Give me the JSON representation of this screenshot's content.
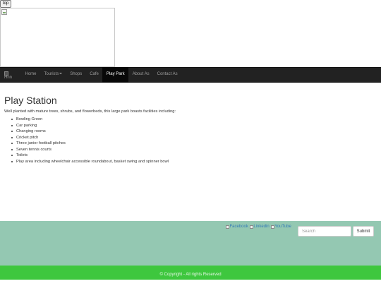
{
  "top_button": {
    "label": "top"
  },
  "navbar": {
    "logo_alt": "Hnn",
    "items": [
      {
        "label": "Home"
      },
      {
        "label": "Tourists"
      },
      {
        "label": "Shops"
      },
      {
        "label": "Cafe"
      },
      {
        "label": "Play Park"
      },
      {
        "label": "About As"
      },
      {
        "label": "Contact As"
      }
    ]
  },
  "main": {
    "title": "Play Station",
    "intro": "Well planted with mature trees, shrubs, and flowerbeds, this large park boasts facilities including:",
    "facilities": [
      "Bowling Green",
      "Car parking",
      "Changing rooms",
      "Cricket pitch",
      "Three junior football pitches",
      "Seven tennis courts",
      "Toilets",
      "Play area including wheelchair accessible roundabout, basket swing and spinner bowl"
    ]
  },
  "footer": {
    "social": [
      {
        "label": "Facebook",
        "icon": "facebook-icon"
      },
      {
        "label": "Linkedin",
        "icon": "linkedin-icon"
      },
      {
        "label": "YouTube",
        "icon": "youtube-icon"
      }
    ],
    "search_placeholder": "Search",
    "submit_label": "Submit",
    "copyright": "© Copyright - All rights Reserved"
  },
  "colors": {
    "navbar_bg": "#222222",
    "nav_active_bg": "#080808",
    "footer_top_bg": "#94c8b2",
    "footer_bottom_bg": "#3ec73e",
    "link": "#337ab7"
  }
}
